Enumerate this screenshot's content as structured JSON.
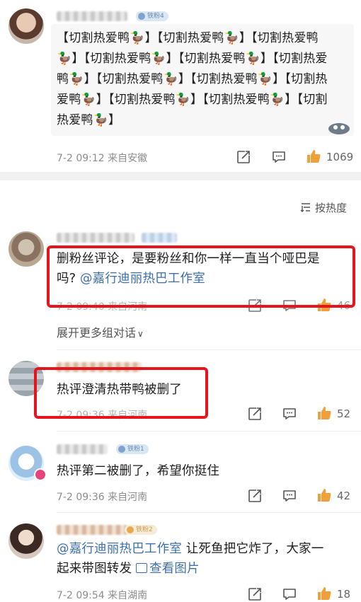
{
  "top_comment": {
    "badge": "铁粉4",
    "text_lines": [
      "【切割热爱鸭🦆】【切割热爱鸭🦆】【切割热爱鸭",
      "🦆】【切割热爱鸭🦆】【切割热爱鸭🦆】【切割热爱",
      "鸭🦆】【切割热爱鸭🦆】【切割热爱鸭🦆】【切割热",
      "爱鸭🦆】【切割热爱鸭🦆】【切割热爱鸭🦆】【切割",
      "热爱鸭🦆】"
    ],
    "meta": "7-2 09:12  来自安徽",
    "likes": "1069"
  },
  "sort": {
    "label": "按热度",
    "icon": "sort-icon"
  },
  "replies": [
    {
      "text_line1": "删粉丝评论，是要粉丝和你一样一直当个哑巴是",
      "text_line2_plain": "吗? ",
      "mention": "@嘉行迪丽热巴工作室",
      "meta": "7-2 09:40  来自河南",
      "likes": "46"
    },
    {
      "text": "热评澄清热带鸭被删了",
      "meta": "7-2 09:36  来自河南",
      "likes": "52"
    },
    {
      "badge": "铁粉1",
      "text": "热评第二被删了，希望你挺住",
      "meta": "7-2 09:36  来自河南",
      "likes": "42"
    },
    {
      "badge": "铁粉2",
      "mention": "@嘉行迪丽热巴工作室",
      "text_line1_rest": " 让死鱼把它炸了，大家一",
      "text_line2": "起来带图转发 ",
      "view_image": "查看图片",
      "meta": "7-2 09:54  来自湖南",
      "likes": "18"
    }
  ],
  "expand_label": "展开更多组对话",
  "colors": {
    "highlight_box": "#e8141c",
    "link": "#3d6fae",
    "like_icon": "#f0a03a",
    "meta_text": "#8d8d8d"
  }
}
